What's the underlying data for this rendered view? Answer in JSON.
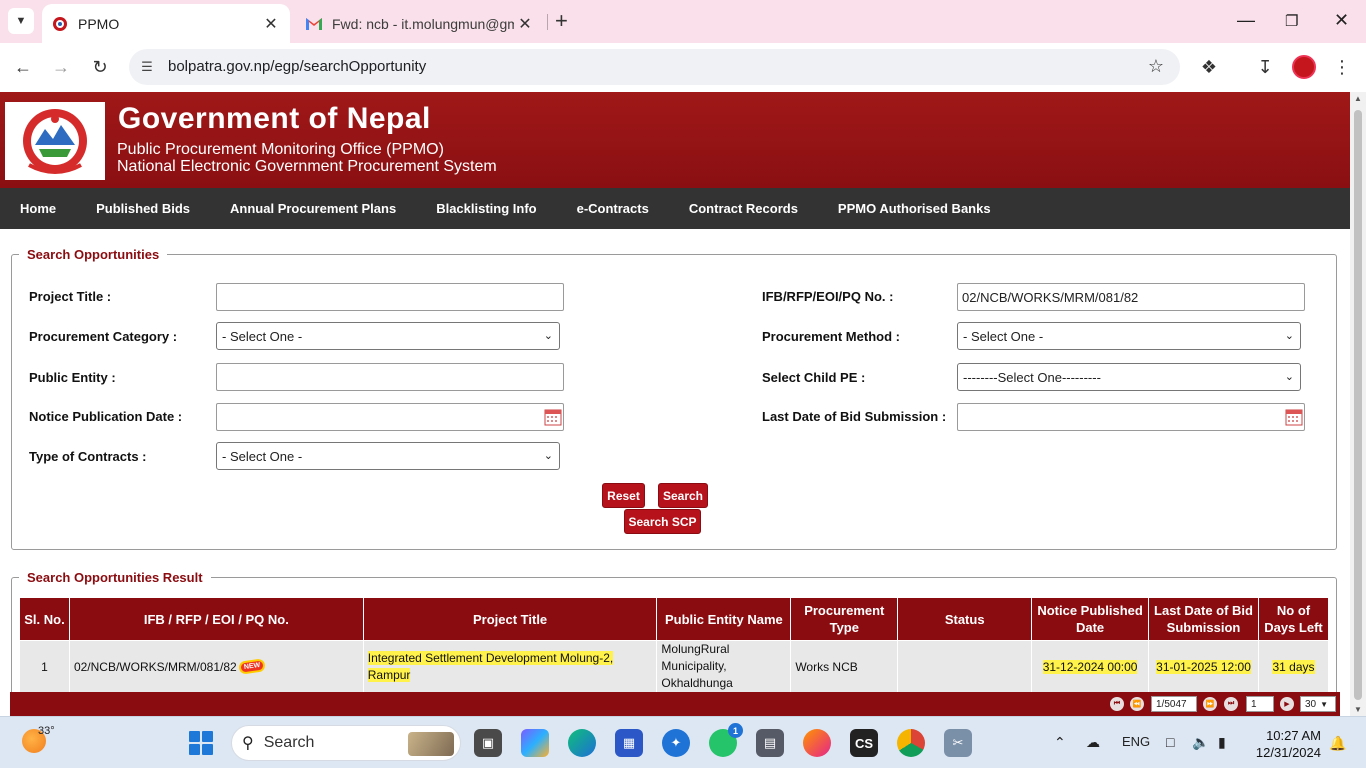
{
  "browser": {
    "tabs": [
      {
        "title": "PPMO",
        "active": true
      },
      {
        "title": "Fwd: ncb - it.molungmun@gma",
        "active": false
      }
    ],
    "url": "bolpatra.gov.np/egp/searchOpportunity"
  },
  "header": {
    "title": "Government of Nepal",
    "subtitle1": "Public Procurement Monitoring Office (PPMO)",
    "subtitle2": "National Electronic Government Procurement System"
  },
  "nav": [
    "Home",
    "Published Bids",
    "Annual Procurement Plans",
    "Blacklisting Info",
    "e-Contracts",
    "Contract Records",
    "PPMO Authorised Banks"
  ],
  "search": {
    "legend": "Search Opportunities",
    "project_title_label": "Project Title :",
    "project_title_value": "",
    "ifb_label": "IFB/RFP/EOI/PQ No. :",
    "ifb_value": "02/NCB/WORKS/MRM/081/82",
    "procurement_category_label": "Procurement Category :",
    "procurement_category_value": "- Select One -",
    "procurement_method_label": "Procurement Method :",
    "procurement_method_value": "- Select One -",
    "public_entity_label": "Public Entity :",
    "public_entity_value": "",
    "child_pe_label": "Select Child PE :",
    "child_pe_value": "--------Select One---------",
    "notice_date_label": "Notice Publication Date :",
    "notice_date_value": "",
    "last_date_label": "Last Date of Bid Submission :",
    "last_date_value": "",
    "contract_type_label": "Type of Contracts :",
    "contract_type_value": "- Select One -",
    "reset_label": "Reset",
    "search_label": "Search",
    "search_scp_label": "Search SCP"
  },
  "results": {
    "legend": "Search Opportunities Result",
    "columns": [
      "Sl. No.",
      "IFB / RFP / EOI / PQ No.",
      "Project Title",
      "Public Entity Name",
      "Procurement Type",
      "Status",
      "Notice Published Date",
      "Last Date of Bid Submission",
      "No of Days Left"
    ],
    "rows": [
      {
        "sl": "1",
        "ifb": "02/NCB/WORKS/MRM/081/82",
        "new_badge": "NEW",
        "project_title": "Integrated Settlement Development Molung-2, Rampur",
        "public_entity": "MolungRural Municipality, Okhaldhunga",
        "procurement_type": "Works  NCB",
        "status": "",
        "notice_published": "31-12-2024 00:00",
        "last_date": "31-01-2025 12:00",
        "days_left": "31 days"
      }
    ],
    "pager": {
      "page_of": "1/5047",
      "page_input": "1",
      "page_size": "30"
    }
  },
  "taskbar": {
    "temperature": "33°",
    "search_label": "Search",
    "language": "ENG",
    "time": "10:27 AM",
    "date": "12/31/2024",
    "whatsapp_badge": "1"
  },
  "colors": {
    "brand_red": "#8b0c10",
    "button_red": "#b5121b",
    "nav_dark": "#333333",
    "highlight": "#fff24a"
  }
}
